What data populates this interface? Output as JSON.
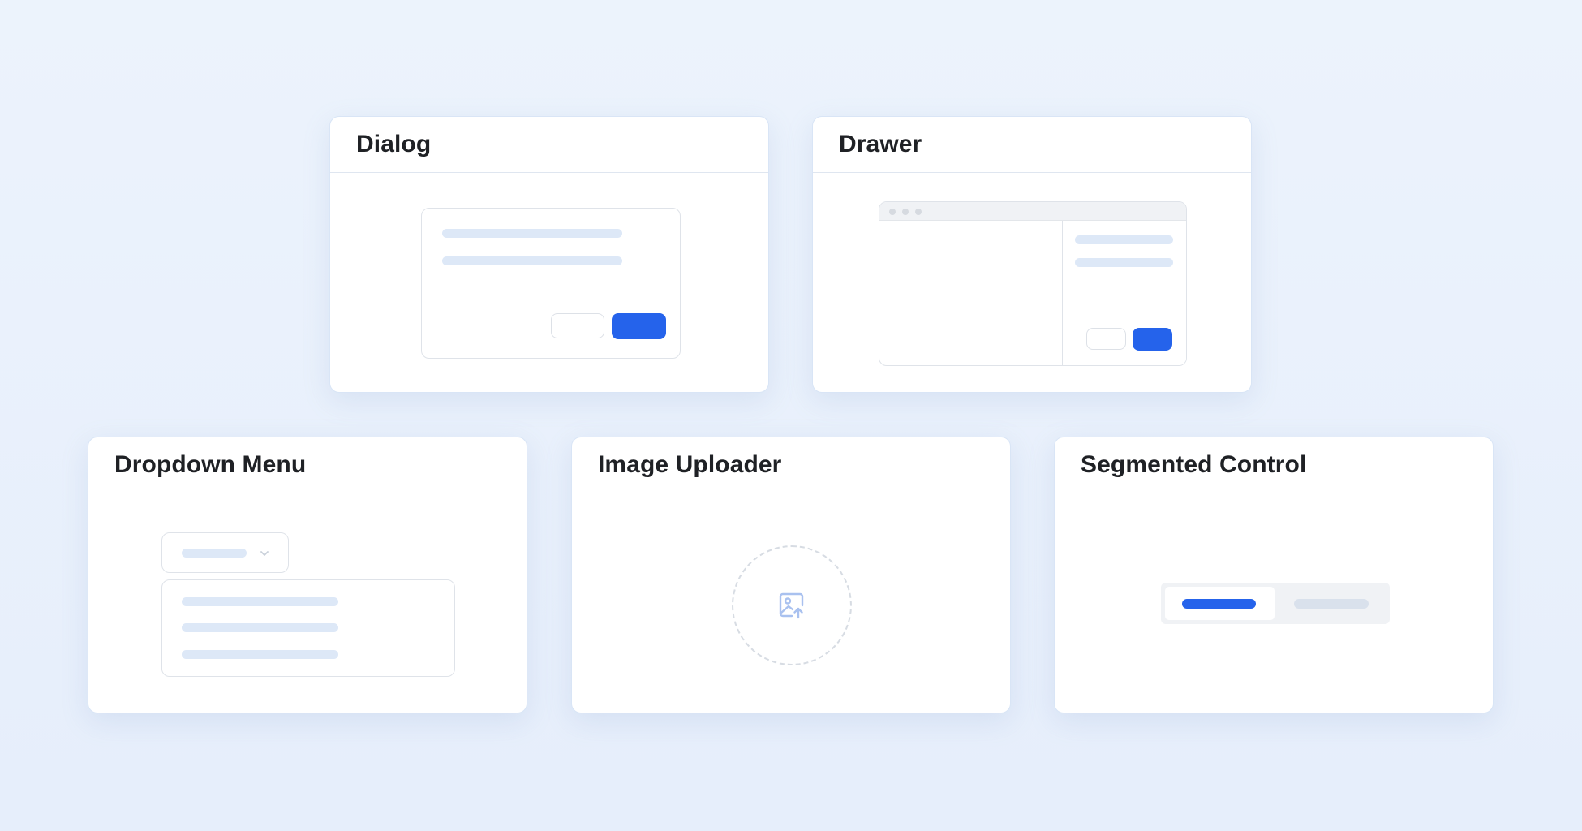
{
  "cards": [
    {
      "title": "Dialog"
    },
    {
      "title": "Drawer"
    },
    {
      "title": "Dropdown Menu"
    },
    {
      "title": "Image Uploader"
    },
    {
      "title": "Segmented Control"
    }
  ],
  "colors": {
    "background": "#ebf2fc",
    "card": "#ffffff",
    "accent": "#2563eb",
    "placeholder_bar": "#dde8f7",
    "divider": "#dfe6f0"
  },
  "icons": {
    "image_uploader": "image-upload-icon",
    "dropdown": "chevron-down-icon"
  }
}
